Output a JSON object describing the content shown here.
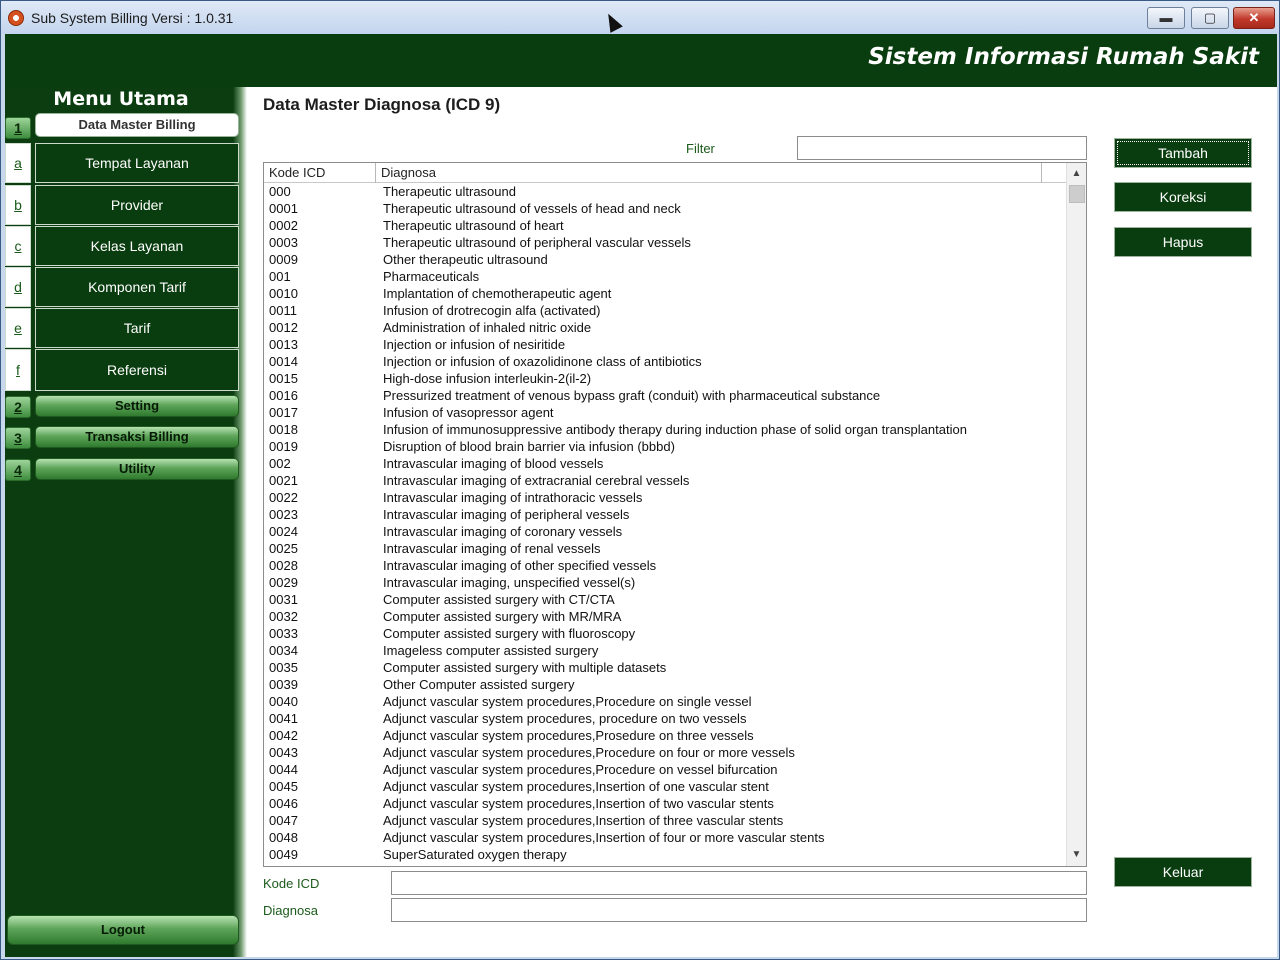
{
  "window": {
    "title": "Sub System Billing Versi : 1.0.31",
    "min_glyph": "▬",
    "max_glyph": "▢",
    "close_glyph": "✕"
  },
  "header": {
    "system_title": "Sistem Informasi Rumah Sakit"
  },
  "sidebar": {
    "title": "Menu Utama",
    "items": [
      {
        "key": "1",
        "label": "Data Master Billing",
        "type": "group-active"
      },
      {
        "key": "a",
        "label": "Tempat Layanan"
      },
      {
        "key": "b",
        "label": "Provider"
      },
      {
        "key": "c",
        "label": "Kelas Layanan"
      },
      {
        "key": "d",
        "label": "Komponen Tarif"
      },
      {
        "key": "e",
        "label": "Tarif"
      },
      {
        "key": "f",
        "label": "Referensi"
      },
      {
        "key": "2",
        "label": "Setting",
        "type": "group"
      },
      {
        "key": "3",
        "label": "Transaksi Billing",
        "type": "group"
      },
      {
        "key": "4",
        "label": "Utility",
        "type": "group"
      }
    ],
    "logout_label": "Logout"
  },
  "main": {
    "page_title": "Data Master Diagnosa (ICD 9)",
    "filter_label": "Filter",
    "filter_value": "",
    "columns": [
      "Kode ICD",
      "Diagnosa"
    ],
    "rows": [
      [
        "000",
        "Therapeutic ultrasound"
      ],
      [
        "0001",
        "Therapeutic ultrasound of vessels of head and neck"
      ],
      [
        "0002",
        "Therapeutic ultrasound of heart"
      ],
      [
        "0003",
        "Therapeutic ultrasound of peripheral vascular vessels"
      ],
      [
        "0009",
        "Other therapeutic ultrasound"
      ],
      [
        "001",
        "Pharmaceuticals"
      ],
      [
        "0010",
        "Implantation of chemotherapeutic agent"
      ],
      [
        "0011",
        "Infusion of drotrecogin alfa (activated)"
      ],
      [
        "0012",
        "Administration of inhaled nitric oxide"
      ],
      [
        "0013",
        "Injection or infusion of nesiritide"
      ],
      [
        "0014",
        "Injection or infusion of oxazolidinone class of antibiotics"
      ],
      [
        "0015",
        "High-dose infusion interleukin-2(il-2)"
      ],
      [
        "0016",
        "Pressurized treatment of venous bypass graft (conduit) with pharmaceutical substance"
      ],
      [
        "0017",
        "Infusion of vasopressor agent"
      ],
      [
        "0018",
        "Infusion of immunosuppressive antibody therapy during induction phase of solid organ transplantation"
      ],
      [
        "0019",
        "Disruption of blood brain barrier via infusion (bbbd)"
      ],
      [
        "002",
        "Intravascular imaging of blood vessels"
      ],
      [
        "0021",
        "Intravascular imaging of extracranial cerebral vessels"
      ],
      [
        "0022",
        "Intravascular imaging of intrathoracic vessels"
      ],
      [
        "0023",
        "Intravascular imaging of peripheral vessels"
      ],
      [
        "0024",
        "Intravascular imaging of coronary vessels"
      ],
      [
        "0025",
        "Intravascular imaging of renal vessels"
      ],
      [
        "0028",
        "Intravascular imaging of other specified vessels"
      ],
      [
        "0029",
        "Intravascular imaging, unspecified vessel(s)"
      ],
      [
        "0031",
        "Computer assisted surgery with CT/CTA"
      ],
      [
        "0032",
        "Computer assisted surgery with MR/MRA"
      ],
      [
        "0033",
        "Computer assisted surgery with fluoroscopy"
      ],
      [
        "0034",
        "Imageless computer assisted surgery"
      ],
      [
        "0035",
        "Computer assisted surgery with multiple datasets"
      ],
      [
        "0039",
        "Other Computer assisted surgery"
      ],
      [
        "0040",
        "Adjunct vascular system procedures,Procedure on single vessel"
      ],
      [
        "0041",
        "Adjunct vascular system procedures, procedure on two vessels"
      ],
      [
        "0042",
        "Adjunct vascular system procedures,Prosedure on three vessels"
      ],
      [
        "0043",
        "Adjunct vascular system procedures,Procedure on four or more vessels"
      ],
      [
        "0044",
        "Adjunct vascular system procedures,Procedure on vessel bifurcation"
      ],
      [
        "0045",
        "Adjunct vascular system procedures,Insertion of one vascular stent"
      ],
      [
        "0046",
        "Adjunct vascular system procedures,Insertion of two vascular stents"
      ],
      [
        "0047",
        "Adjunct vascular system procedures,Insertion of three vascular stents"
      ],
      [
        "0048",
        "Adjunct vascular system procedures,Insertion of four or more vascular stents"
      ],
      [
        "0049",
        "SuperSaturated oxygen therapy"
      ]
    ],
    "kode_label": "Kode ICD",
    "kode_value": "",
    "diagnosa_label": "Diagnosa",
    "diagnosa_value": ""
  },
  "actions": {
    "tambah": "Tambah",
    "koreksi": "Koreksi",
    "hapus": "Hapus",
    "keluar": "Keluar"
  },
  "colors": {
    "primary_green": "#093c0e",
    "header_text": "#ffffff",
    "label_green": "#1b5a1b"
  }
}
